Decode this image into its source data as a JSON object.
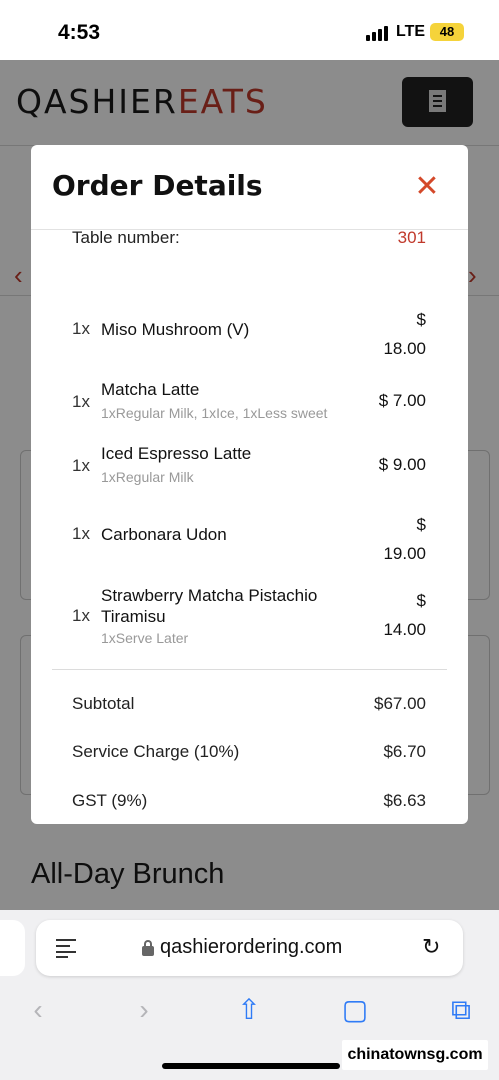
{
  "status_bar": {
    "time": "4:53",
    "network": "LTE",
    "battery": "48"
  },
  "header": {
    "logo_part1": "QASHIER",
    "logo_part2": "EATS",
    "menu_icon": "receipt-icon"
  },
  "background": {
    "section_title": "All-Day Brunch"
  },
  "modal": {
    "title": "Order Details",
    "close_icon": "close-icon",
    "table_label": "Table number:",
    "table_value": "301",
    "items": [
      {
        "qty": "1x",
        "name": "Miso Mushroom (V)",
        "mods": "",
        "price_line1": "$",
        "price_line2": "18.00"
      },
      {
        "qty": "1x",
        "name": "Matcha Latte",
        "mods": "1xRegular Milk, 1xIce, 1xLess sweet",
        "price_line1": "$ 7.00",
        "price_line2": ""
      },
      {
        "qty": "1x",
        "name": "Iced Espresso Latte",
        "mods": "1xRegular Milk",
        "price_line1": "$ 9.00",
        "price_line2": ""
      },
      {
        "qty": "1x",
        "name": "Carbonara Udon",
        "mods": "",
        "price_line1": "$",
        "price_line2": "19.00"
      },
      {
        "qty": "1x",
        "name": "Strawberry Matcha Pistachio Tiramisu",
        "mods": "1xServe Later",
        "price_line1": "$",
        "price_line2": "14.00"
      }
    ],
    "totals": [
      {
        "label": "Subtotal",
        "value": "$67.00"
      },
      {
        "label": "Service Charge (10%)",
        "value": "$6.70"
      },
      {
        "label": "GST (9%)",
        "value": "$6.63"
      }
    ]
  },
  "browser": {
    "url": "qashierordering.com"
  },
  "watermark": "chinatownsg.com",
  "colors": {
    "accent": "#c0392b",
    "close": "#d4492a",
    "ios_blue": "#2f7bf6"
  }
}
